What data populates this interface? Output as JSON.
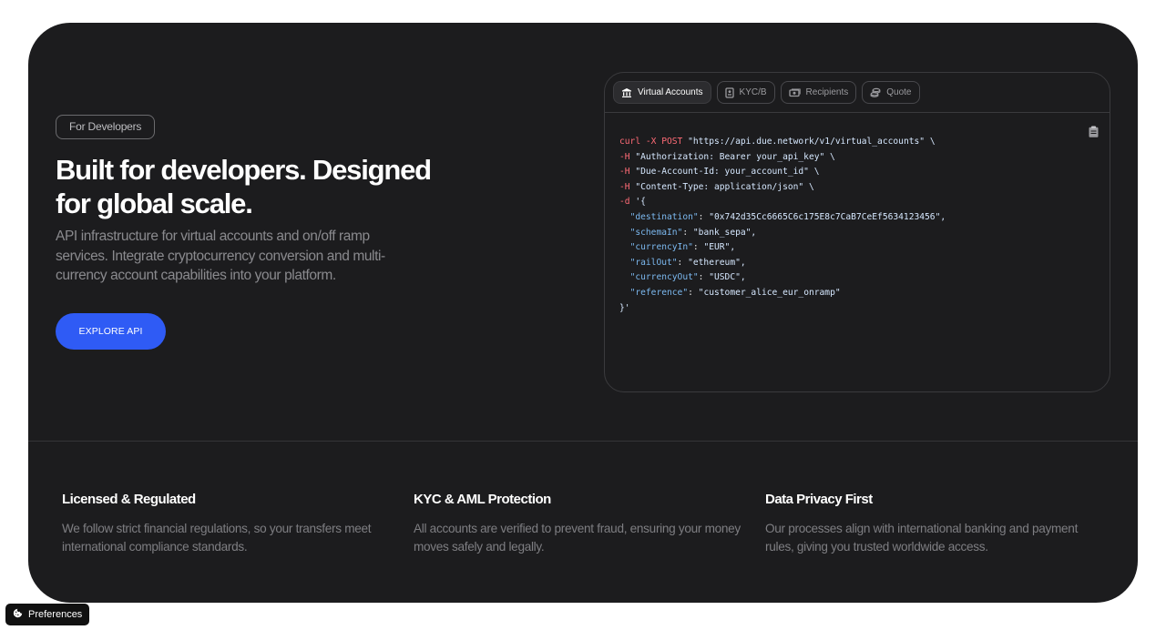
{
  "hero": {
    "tag": "For Developers",
    "headline": "Built for developers. Designed for global scale.",
    "subtext": "API infrastructure for virtual accounts and on/off ramp services. Integrate cryptocurrency conversion and multi-currency account capabilities into your platform.",
    "cta_label": "EXPLORE API"
  },
  "code_panel": {
    "tabs": [
      {
        "label": "Virtual Accounts",
        "icon": "bank-icon",
        "active": true
      },
      {
        "label": "KYC/B",
        "icon": "id-card-icon",
        "active": false
      },
      {
        "label": "Recipients",
        "icon": "money-icon",
        "active": false
      },
      {
        "label": "Quote",
        "icon": "coins-icon",
        "active": false
      }
    ],
    "copy_icon": "clipboard-icon",
    "code": {
      "curl": "curl",
      "x_flag": "-X",
      "method": "POST",
      "url": "\"https://api.due.network/v1/virtual_accounts\" \\",
      "h_flag": "-H",
      "header_auth": "\"Authorization: Bearer your_api_key\" \\",
      "header_account": "\"Due-Account-Id: your_account_id\" \\",
      "header_content": "\"Content-Type: application/json\" \\",
      "d_flag": "-d",
      "body_open": "'{",
      "fields": [
        {
          "key": "\"destination\"",
          "value": "\"0x742d35Cc6665C6c175E8c7CaB7CeEf5634123456\","
        },
        {
          "key": "\"schemaIn\"",
          "value": "\"bank_sepa\","
        },
        {
          "key": "\"currencyIn\"",
          "value": "\"EUR\","
        },
        {
          "key": "\"railOut\"",
          "value": "\"ethereum\","
        },
        {
          "key": "\"currencyOut\"",
          "value": "\"USDC\","
        },
        {
          "key": "\"reference\"",
          "value": "\"customer_alice_eur_onramp\""
        }
      ],
      "body_close": "}'"
    }
  },
  "features": [
    {
      "title": "Licensed & Regulated",
      "text": "We follow strict financial regulations, so your transfers meet international compliance standards."
    },
    {
      "title": "KYC & AML Protection",
      "text": "All accounts are verified to prevent fraud, ensuring your money moves safely and legally."
    },
    {
      "title": "Data Privacy First",
      "text": "Our processes align with international banking and payment rules, giving you trusted worldwide access."
    }
  ],
  "preferences": {
    "label": "Preferences",
    "icon": "cookie-icon"
  },
  "colors": {
    "panel_bg": "#1c1c1e",
    "accent": "#2f5bf5",
    "code_command": "#ff6b76",
    "code_key": "#7cb9f0"
  }
}
